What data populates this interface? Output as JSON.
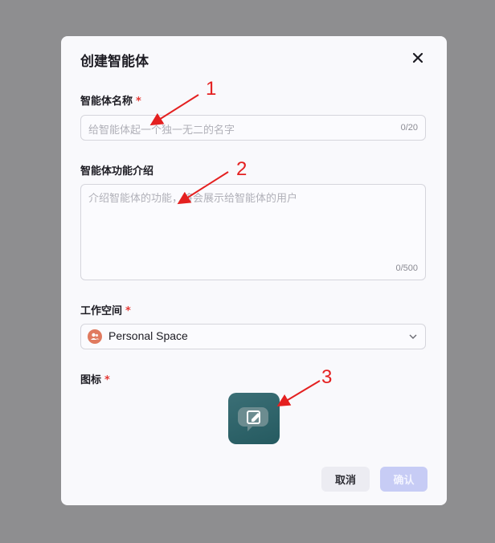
{
  "dialog": {
    "title": "创建智能体",
    "name_label": "智能体名称",
    "required_mark": "*",
    "name_placeholder": "给智能体起一个独一无二的名字",
    "name_count": "0/20",
    "desc_label": "智能体功能介绍",
    "desc_placeholder": "介绍智能体的功能，将会展示给智能体的用户",
    "desc_count": "0/500",
    "workspace_label": "工作空间",
    "workspace_value": "Personal Space",
    "icon_label": "图标",
    "cancel_label": "取消",
    "confirm_label": "确认"
  },
  "annotations": [
    "1",
    "2",
    "3"
  ],
  "colors": {
    "accent_disabled": "#c7ccf5",
    "annotation": "#e42020",
    "overlay": "#8e8e90"
  }
}
